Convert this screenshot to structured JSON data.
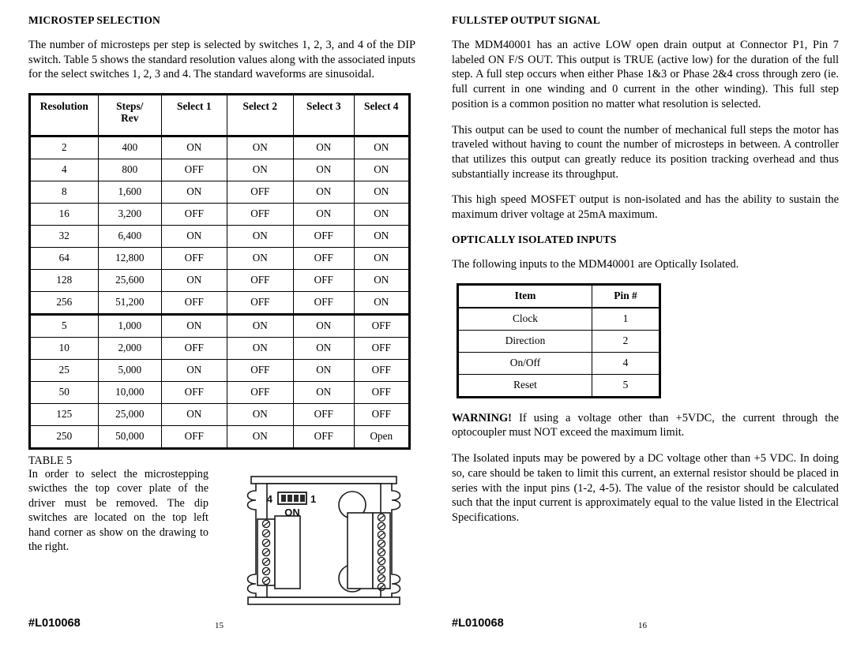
{
  "left_column": {
    "heading": "MICROSTEP SELECTION",
    "intro_paragraph": "The number of microsteps per step is selected by switches 1, 2, 3, and 4 of the DIP switch.  Table 5 shows the standard resolution values  along with the associated inputs for the select switches 1, 2, 3 and 4.  The standard waveforms are sinusoidal.",
    "table_caption": "TABLE 5",
    "instructions_paragraph": "In order to select the microstepping swicthes the top cover plate of the driver must be removed.  The dip switches are located on the top left hand corner as show on the drawing to the right."
  },
  "microstep_table": {
    "headers": [
      "Resolution",
      "Steps/ Rev",
      "Select 1",
      "Select 2",
      "Select 3",
      "Select 4"
    ],
    "header_lines": {
      "col0": "Resolution",
      "col1_line1": "Steps/",
      "col1_line2": "Rev",
      "col2": "Select 1",
      "col3": "Select 2",
      "col4": "Select 3",
      "col5": "Select 4"
    },
    "rows": [
      {
        "resolution": "2",
        "steps_rev": "400",
        "select1": "ON",
        "select2": "ON",
        "select3": "ON",
        "select4": "ON"
      },
      {
        "resolution": "4",
        "steps_rev": "800",
        "select1": "OFF",
        "select2": "ON",
        "select3": "ON",
        "select4": "ON"
      },
      {
        "resolution": "8",
        "steps_rev": "1,600",
        "select1": "ON",
        "select2": "OFF",
        "select3": "ON",
        "select4": "ON"
      },
      {
        "resolution": "16",
        "steps_rev": "3,200",
        "select1": "OFF",
        "select2": "OFF",
        "select3": "ON",
        "select4": "ON"
      },
      {
        "resolution": "32",
        "steps_rev": "6,400",
        "select1": "ON",
        "select2": "ON",
        "select3": "OFF",
        "select4": "ON"
      },
      {
        "resolution": "64",
        "steps_rev": "12,800",
        "select1": "OFF",
        "select2": "ON",
        "select3": "OFF",
        "select4": "ON"
      },
      {
        "resolution": "128",
        "steps_rev": "25,600",
        "select1": "ON",
        "select2": "OFF",
        "select3": "OFF",
        "select4": "ON"
      },
      {
        "resolution": "256",
        "steps_rev": "51,200",
        "select1": "OFF",
        "select2": "OFF",
        "select3": "OFF",
        "select4": "ON"
      },
      {
        "resolution": "5",
        "steps_rev": "1,000",
        "select1": "ON",
        "select2": "ON",
        "select3": "ON",
        "select4": "OFF"
      },
      {
        "resolution": "10",
        "steps_rev": "2,000",
        "select1": "OFF",
        "select2": "ON",
        "select3": "ON",
        "select4": "OFF"
      },
      {
        "resolution": "25",
        "steps_rev": "5,000",
        "select1": "ON",
        "select2": "OFF",
        "select3": "ON",
        "select4": "OFF"
      },
      {
        "resolution": "50",
        "steps_rev": "10,000",
        "select1": "OFF",
        "select2": "OFF",
        "select3": "ON",
        "select4": "OFF"
      },
      {
        "resolution": "125",
        "steps_rev": "25,000",
        "select1": "ON",
        "select2": "ON",
        "select3": "OFF",
        "select4": "OFF"
      },
      {
        "resolution": "250",
        "steps_rev": "50,000",
        "select1": "OFF",
        "select2": "ON",
        "select3": "OFF",
        "select4": "Open"
      }
    ],
    "group_break_after_row_index": 7
  },
  "drawing": {
    "name": "driver-top-view-drawing",
    "dip_switch_left_label": "4",
    "dip_switch_right_label": "1",
    "dip_switch_on_label": "ON",
    "dip_switch_positions": 4,
    "left_terminal_screws": 7,
    "right_terminal_screws": 9,
    "mounting_holes": 2
  },
  "right_column": {
    "heading_1": "FULLSTEP OUTPUT SIGNAL",
    "paragraph_1": "The MDM40001 has an active LOW open drain output at Connector P1, Pin 7 labeled ON F/S OUT.  This output is TRUE (active low) for the duration of the full step.  A full step occurs when either Phase 1&3 or Phase 2&4 cross through zero (ie. full current in one winding and 0 current in the other winding).  This full step position is a common position no matter what resolution is selected.",
    "paragraph_2": "This output can be used to count the number of mechanical full steps the motor has traveled without having to count the number of microsteps in between.  A controller that utilizes this output can greatly reduce its position tracking overhead and thus substantially increase its throughput.",
    "paragraph_3": "This high speed MOSFET output is non-isolated and has the ability to sustain the maximum driver voltage at 25mA maximum.",
    "heading_2": "OPTICALLY ISOLATED INPUTS",
    "paragraph_4": "The following inputs to the MDM40001 are Optically Isolated.",
    "warning_label": "WARNING!",
    "warning_text": "  If using a voltage other than +5VDC, the current through the optocoupler must NOT exceed the maximum limit.",
    "paragraph_5": "The Isolated inputs may be powered by a DC voltage other than +5 VDC.  In doing so, care should be taken to limit this current, an external resistor should be placed in series with the input pins (1-2, 4-5). The value of the resistor should be calculated such that the input current is approximately equal to the value listed in the Electrical Specifications."
  },
  "pin_table": {
    "headers": [
      "Item",
      "Pin #"
    ],
    "rows": [
      {
        "item": "Clock",
        "pin": "1"
      },
      {
        "item": "Direction",
        "pin": "2"
      },
      {
        "item": "On/Off",
        "pin": "4"
      },
      {
        "item": "Reset",
        "pin": "5"
      }
    ]
  },
  "footer_left": {
    "doc_number": "#L010068",
    "page_number": "15"
  },
  "footer_right": {
    "doc_number": "#L010068",
    "page_number": "16"
  },
  "colors": {
    "text": "#000000",
    "background": "#ffffff",
    "rule": "#000000"
  }
}
